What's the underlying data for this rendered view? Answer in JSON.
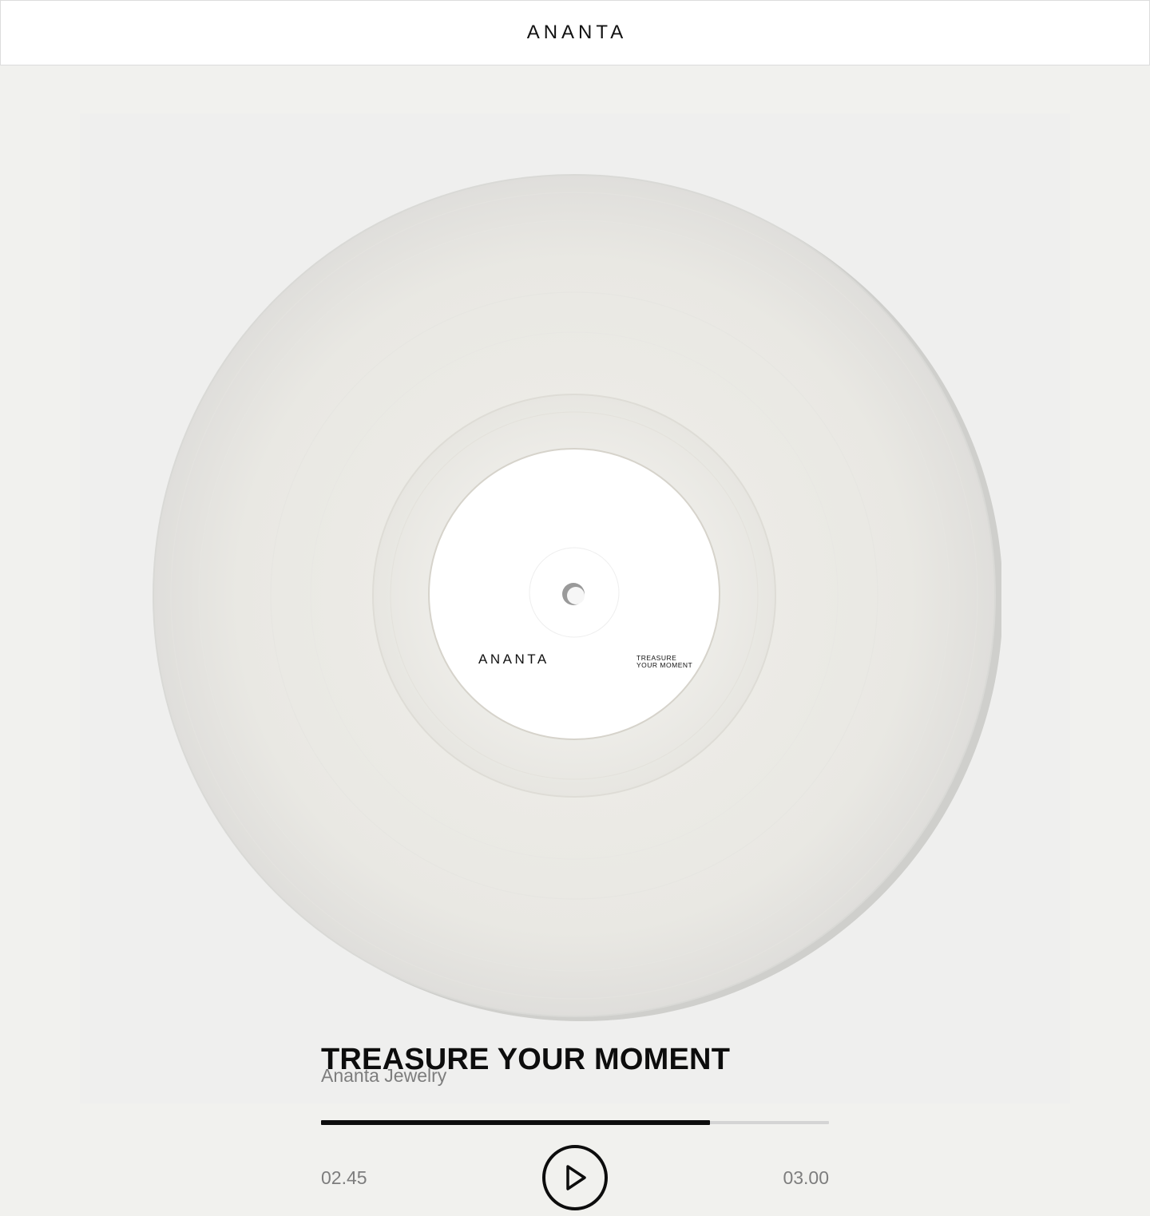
{
  "header": {
    "brand": "ANANTA"
  },
  "record": {
    "label_brand": "ANANTA",
    "label_line1": "TREASURE",
    "label_line2": "YOUR MOMENT"
  },
  "player": {
    "title": "TREASURE YOUR MOMENT",
    "artist": "Ananta Jewelry",
    "elapsed": "02.45",
    "total": "03.00",
    "progress": 0.765,
    "play_icon": "play-icon"
  },
  "colors": {
    "background": "#f1f1ee",
    "accent": "#0d0d0d",
    "muted_text": "#7d7d7d",
    "track": "#d4d4d4"
  }
}
